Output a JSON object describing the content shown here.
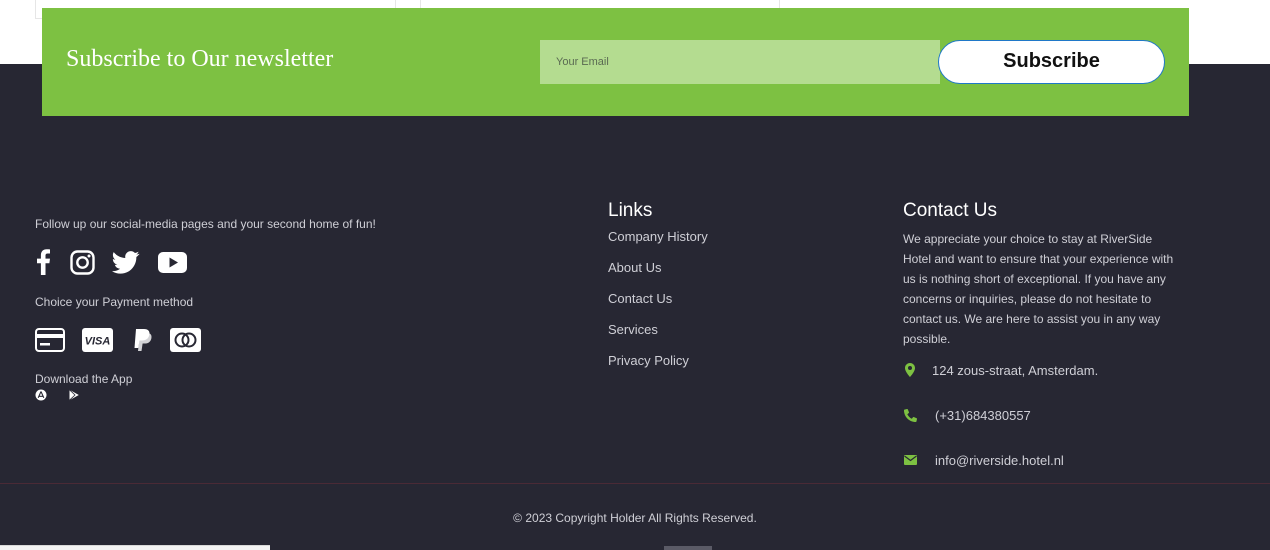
{
  "newsletter": {
    "title": "Subscribe to Our newsletter",
    "email_placeholder": "Your Email",
    "subscribe_label": "Subscribe"
  },
  "social": {
    "follow_text": "Follow up our social-media pages and your second home of fun!",
    "icons": [
      "facebook-icon",
      "instagram-icon",
      "twitter-icon",
      "youtube-icon"
    ]
  },
  "payment": {
    "label": "Choice your Payment method",
    "icons": [
      "credit-card-icon",
      "visa-icon",
      "paypal-icon",
      "mastercard-icon"
    ]
  },
  "app": {
    "label": "Download the App",
    "icons": [
      "app-store-icon",
      "google-play-icon"
    ]
  },
  "links": {
    "heading": "Links",
    "items": [
      "Company History",
      "About Us",
      "Contact Us",
      "Services",
      "Privacy Policy"
    ]
  },
  "contact": {
    "heading": "Contact Us",
    "description": "We appreciate your choice to stay at RiverSide Hotel and want to ensure that your experience with us is nothing short of exceptional. If you have any concerns or inquiries, please do not hesitate to contact us. We are here to assist you in any way possible.",
    "address": "124 zous-straat, Amsterdam.",
    "phone": "(+31)684380557",
    "email": "info@riverside.hotel.nl"
  },
  "copyright": "© 2023 Copyright Holder All Rights Reserved.",
  "colors": {
    "accent": "#7dc142",
    "footer_bg": "#272733",
    "text": "#cfcfd6"
  }
}
